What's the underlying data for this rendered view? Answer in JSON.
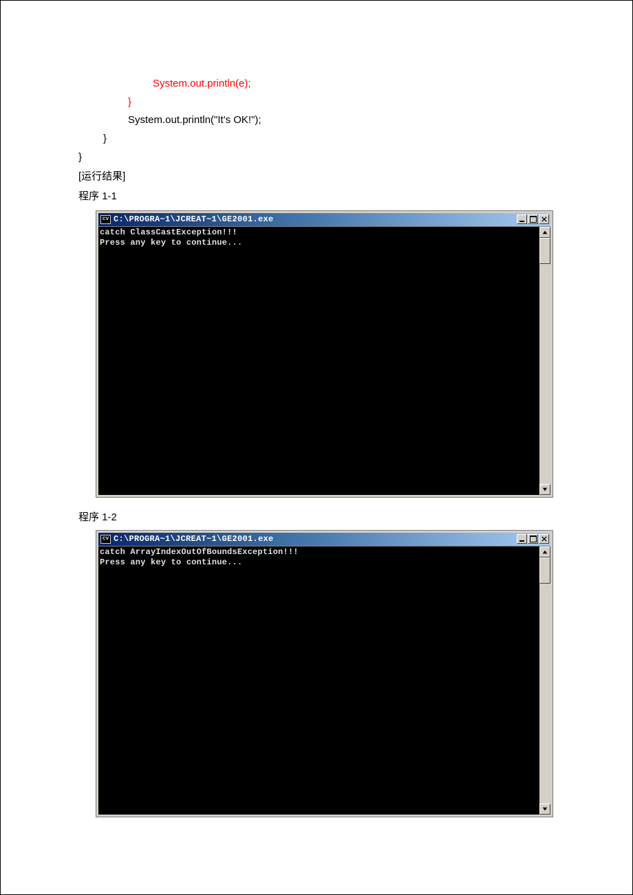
{
  "code": {
    "line1": "System.out.println(e);",
    "line2": "}",
    "line3": "System.out.println(\"It's OK!\");",
    "line4": "}",
    "line5": "}"
  },
  "captions": {
    "run_result": "[运行结果]",
    "prog11": "程序 1-1",
    "prog12": "程序 1-2"
  },
  "console1": {
    "icon": "cv",
    "title": "C:\\PROGRA~1\\JCREAT~1\\GE2001.exe",
    "output": "catch ClassCastException!!!\nPress any key to continue..."
  },
  "console2": {
    "icon": "cv",
    "title": "C:\\PROGRA~1\\JCREAT~1\\GE2001.exe",
    "output": "catch ArrayIndexOutOfBoundsException!!!\nPress any key to continue..."
  }
}
